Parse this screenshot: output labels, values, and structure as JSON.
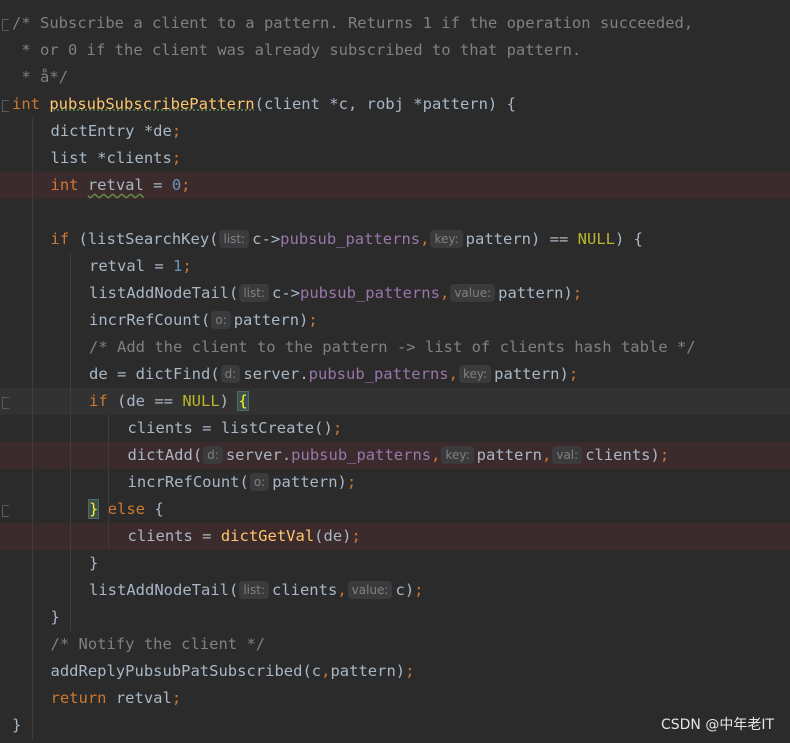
{
  "editor": {
    "language": "C",
    "theme_colors": {
      "background": "#2b2b2b",
      "comment": "#808080",
      "keyword": "#cc7832",
      "function": "#ffc66d",
      "number": "#6897bb",
      "macro": "#bbb529",
      "field": "#9876aa",
      "identifier": "#a9b7c6",
      "error_line": "#3c2b2d",
      "param_hint_bg": "#3b3b3d"
    },
    "lines": [
      {
        "indent": 0,
        "tokens": [
          {
            "t": "comment",
            "v": "/* Subscribe a client to a pattern. Returns 1 if the operation succeeded,"
          }
        ]
      },
      {
        "indent": 0,
        "tokens": [
          {
            "t": "comment",
            "v": " * or 0 if the client was already subscribed to that pattern."
          }
        ]
      },
      {
        "indent": 0,
        "tokens": [
          {
            "t": "comment",
            "v": " * å*/"
          }
        ]
      },
      {
        "indent": 0,
        "tokens": [
          {
            "t": "keyword",
            "v": "int "
          },
          {
            "t": "fn-decl",
            "v": "pubsubSubscribePattern"
          },
          {
            "t": "ident",
            "v": "(client *c, robj *pattern) {"
          }
        ]
      },
      {
        "indent": 1,
        "tokens": [
          {
            "t": "ident",
            "v": "dictEntry *de"
          },
          {
            "t": "punct",
            "v": ";"
          }
        ]
      },
      {
        "indent": 1,
        "tokens": [
          {
            "t": "ident",
            "v": "list *clients"
          },
          {
            "t": "punct",
            "v": ";"
          }
        ]
      },
      {
        "indent": 1,
        "bg": "error",
        "tokens": [
          {
            "t": "keyword",
            "v": "int "
          },
          {
            "t": "ident-squiggle",
            "v": "retval"
          },
          {
            "t": "ident",
            "v": " = "
          },
          {
            "t": "num",
            "v": "0"
          },
          {
            "t": "punct",
            "v": ";"
          }
        ]
      },
      {
        "indent": 0,
        "tokens": []
      },
      {
        "indent": 1,
        "tokens": [
          {
            "t": "keyword",
            "v": "if "
          },
          {
            "t": "ident",
            "v": "(listSearchKey("
          },
          {
            "t": "hint",
            "v": "list:"
          },
          {
            "t": "ident",
            "v": "c->"
          },
          {
            "t": "field",
            "v": "pubsub_patterns"
          },
          {
            "t": "punct",
            "v": ","
          },
          {
            "t": "hint",
            "v": "key:"
          },
          {
            "t": "ident",
            "v": "pattern) == "
          },
          {
            "t": "macro",
            "v": "NULL"
          },
          {
            "t": "ident",
            "v": ") {"
          }
        ]
      },
      {
        "indent": 2,
        "tokens": [
          {
            "t": "ident",
            "v": "retval = "
          },
          {
            "t": "num",
            "v": "1"
          },
          {
            "t": "punct",
            "v": ";"
          }
        ]
      },
      {
        "indent": 2,
        "tokens": [
          {
            "t": "ident",
            "v": "listAddNodeTail("
          },
          {
            "t": "hint",
            "v": "list:"
          },
          {
            "t": "ident",
            "v": "c->"
          },
          {
            "t": "field",
            "v": "pubsub_patterns"
          },
          {
            "t": "punct",
            "v": ","
          },
          {
            "t": "hint",
            "v": "value:"
          },
          {
            "t": "ident",
            "v": "pattern)"
          },
          {
            "t": "punct",
            "v": ";"
          }
        ]
      },
      {
        "indent": 2,
        "tokens": [
          {
            "t": "ident",
            "v": "incrRefCount("
          },
          {
            "t": "hint",
            "v": "o:"
          },
          {
            "t": "ident",
            "v": "pattern)"
          },
          {
            "t": "punct",
            "v": ";"
          }
        ]
      },
      {
        "indent": 2,
        "tokens": [
          {
            "t": "comment",
            "v": "/* Add the client to the pattern -> list of clients hash table */"
          }
        ]
      },
      {
        "indent": 2,
        "tokens": [
          {
            "t": "ident",
            "v": "de = dictFind("
          },
          {
            "t": "hint",
            "v": "d:"
          },
          {
            "t": "ident",
            "v": "server."
          },
          {
            "t": "field",
            "v": "pubsub_patterns"
          },
          {
            "t": "punct",
            "v": ","
          },
          {
            "t": "hint",
            "v": "key:"
          },
          {
            "t": "ident",
            "v": "pattern)"
          },
          {
            "t": "punct",
            "v": ";"
          }
        ]
      },
      {
        "indent": 2,
        "bg": "caret",
        "tokens": [
          {
            "t": "keyword",
            "v": "if "
          },
          {
            "t": "ident",
            "v": "(de == "
          },
          {
            "t": "macro",
            "v": "NULL"
          },
          {
            "t": "ident",
            "v": ") "
          },
          {
            "t": "brace",
            "v": "{"
          }
        ]
      },
      {
        "indent": 3,
        "tokens": [
          {
            "t": "ident",
            "v": "clients = listCreate()"
          },
          {
            "t": "punct",
            "v": ";"
          }
        ]
      },
      {
        "indent": 3,
        "bg": "error",
        "tokens": [
          {
            "t": "ident",
            "v": "dictAdd("
          },
          {
            "t": "hint",
            "v": "d:"
          },
          {
            "t": "ident",
            "v": "server."
          },
          {
            "t": "field",
            "v": "pubsub_patterns"
          },
          {
            "t": "punct",
            "v": ","
          },
          {
            "t": "hint",
            "v": "key:"
          },
          {
            "t": "ident",
            "v": "pattern"
          },
          {
            "t": "punct",
            "v": ","
          },
          {
            "t": "hint",
            "v": "val:"
          },
          {
            "t": "ident",
            "v": "clients)"
          },
          {
            "t": "punct",
            "v": ";"
          }
        ]
      },
      {
        "indent": 3,
        "tokens": [
          {
            "t": "ident",
            "v": "incrRefCount("
          },
          {
            "t": "hint",
            "v": "o:"
          },
          {
            "t": "ident",
            "v": "pattern)"
          },
          {
            "t": "punct",
            "v": ";"
          }
        ]
      },
      {
        "indent": 2,
        "tokens": [
          {
            "t": "brace",
            "v": "}"
          },
          {
            "t": "keyword",
            "v": " else "
          },
          {
            "t": "ident",
            "v": "{"
          }
        ]
      },
      {
        "indent": 3,
        "bg": "error",
        "tokens": [
          {
            "t": "ident",
            "v": "clients = "
          },
          {
            "t": "fn",
            "v": "dictGetVal"
          },
          {
            "t": "ident",
            "v": "(de)"
          },
          {
            "t": "punct",
            "v": ";"
          }
        ]
      },
      {
        "indent": 2,
        "tokens": [
          {
            "t": "ident",
            "v": "}"
          }
        ]
      },
      {
        "indent": 2,
        "tokens": [
          {
            "t": "ident",
            "v": "listAddNodeTail("
          },
          {
            "t": "hint",
            "v": "list:"
          },
          {
            "t": "ident",
            "v": "clients"
          },
          {
            "t": "punct",
            "v": ","
          },
          {
            "t": "hint",
            "v": "value:"
          },
          {
            "t": "ident",
            "v": "c)"
          },
          {
            "t": "punct",
            "v": ";"
          }
        ]
      },
      {
        "indent": 1,
        "tokens": [
          {
            "t": "ident",
            "v": "}"
          }
        ]
      },
      {
        "indent": 1,
        "tokens": [
          {
            "t": "comment",
            "v": "/* Notify the client */"
          }
        ]
      },
      {
        "indent": 1,
        "tokens": [
          {
            "t": "ident",
            "v": "addReplyPubsubPatSubscribed(c"
          },
          {
            "t": "punct",
            "v": ","
          },
          {
            "t": "ident",
            "v": "pattern)"
          },
          {
            "t": "punct",
            "v": ";"
          }
        ]
      },
      {
        "indent": 1,
        "tokens": [
          {
            "t": "keyword",
            "v": "return "
          },
          {
            "t": "ident",
            "v": "retval"
          },
          {
            "t": "punct",
            "v": ";"
          }
        ]
      },
      {
        "indent": 0,
        "tokens": [
          {
            "t": "ident",
            "v": "}"
          }
        ]
      }
    ]
  },
  "watermark": {
    "text": "CSDN @中年老IT"
  }
}
